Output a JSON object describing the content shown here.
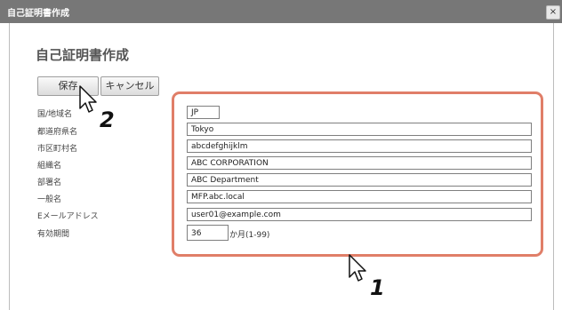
{
  "window": {
    "title": "自己証明書作成",
    "close_label": "×"
  },
  "page": {
    "heading": "自己証明書作成"
  },
  "buttons": {
    "save": "保存",
    "cancel": "キャンセル"
  },
  "form": {
    "country": {
      "label": "国/地域名",
      "value": "JP"
    },
    "state": {
      "label": "都道府県名",
      "value": "Tokyo"
    },
    "city": {
      "label": "市区町村名",
      "value": "abcdefghijklm"
    },
    "organization": {
      "label": "組織名",
      "value": "ABC CORPORATION"
    },
    "department": {
      "label": "部署名",
      "value": "ABC Department"
    },
    "common_name": {
      "label": "一般名",
      "value": "MFP.abc.local"
    },
    "email": {
      "label": "Eメールアドレス",
      "value": "user01@example.com"
    },
    "validity": {
      "label": "有効期間",
      "value": "36",
      "suffix": "か月(1-99)"
    }
  },
  "callouts": {
    "one": "1",
    "two": "2"
  },
  "colors": {
    "titlebar": "#777777",
    "highlight": "#e07e68"
  }
}
